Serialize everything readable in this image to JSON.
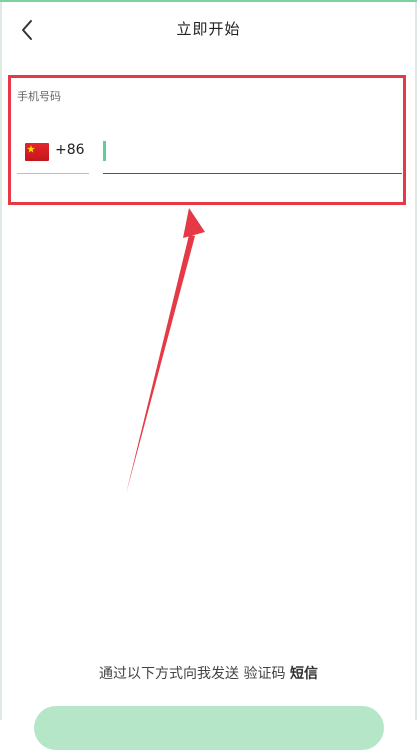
{
  "header": {
    "title": "立即开始"
  },
  "phone_form": {
    "label": "手机号码",
    "country_code": "+86",
    "phone_value": "",
    "phone_placeholder": ""
  },
  "sms_hint": {
    "prefix": "通过以下方式向我发送 验证码",
    "method": "短信"
  },
  "colors": {
    "accent": "#5fcf93",
    "highlight_box": "#e53a45",
    "button": "#b6e6c8"
  }
}
